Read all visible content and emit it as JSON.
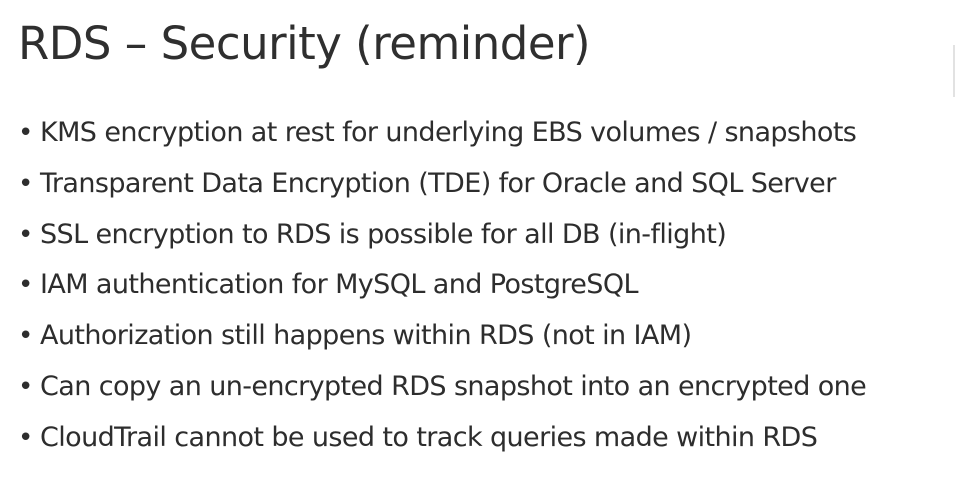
{
  "title": "RDS – Security (reminder)",
  "bullet_symbol": "•",
  "bullets": [
    "KMS encryption at rest for underlying EBS volumes / snapshots",
    "Transparent Data Encryption (TDE) for Oracle and SQL Server",
    "SSL encryption to RDS is possible for all DB (in-flight)",
    "IAM authentication for MySQL and PostgreSQL",
    "Authorization still happens within RDS (not in IAM)",
    "Can copy an un-encrypted RDS snapshot into an encrypted one",
    "CloudTrail cannot be used to track queries made within RDS"
  ]
}
